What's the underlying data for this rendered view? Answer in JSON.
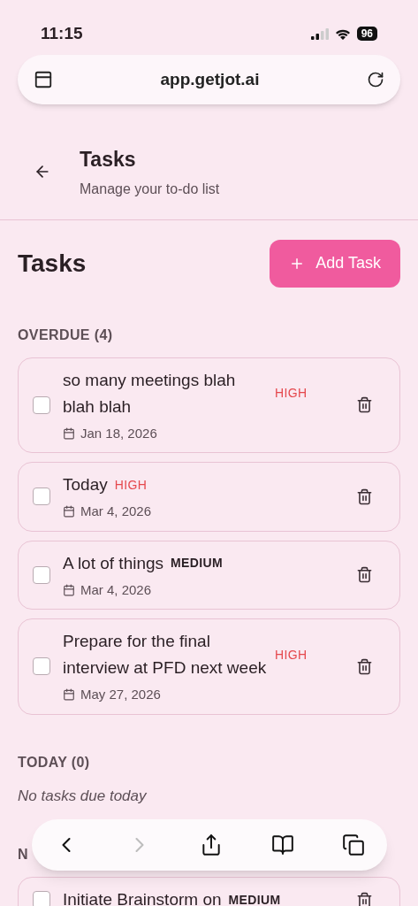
{
  "status_bar": {
    "time": "11:15",
    "battery": "96"
  },
  "address_bar": {
    "url": "app.getjot.ai"
  },
  "header": {
    "title": "Tasks",
    "subtitle": "Manage your to-do list"
  },
  "page": {
    "title": "Tasks",
    "add_button": "Add Task"
  },
  "sections": [
    {
      "heading": "OVERDUE (4)",
      "tasks": [
        {
          "title": "so many meetings blah blah blah",
          "priority": {
            "label": "HIGH",
            "kind": "high"
          },
          "date": "Jan 18, 2026",
          "checked": false
        },
        {
          "title": "Today",
          "priority": {
            "label": "HIGH",
            "kind": "high"
          },
          "date": "Mar 4, 2026",
          "checked": false
        },
        {
          "title": "A lot of things",
          "priority": {
            "label": "MEDIUM",
            "kind": "medium"
          },
          "date": "Mar 4, 2026",
          "checked": false
        },
        {
          "title": "Prepare for the final interview at PFD next week",
          "priority": {
            "label": "HIGH",
            "kind": "high"
          },
          "date": "May 27, 2026",
          "checked": false
        }
      ]
    },
    {
      "heading": "TODAY (0)",
      "empty_message": "No tasks due today"
    },
    {
      "heading": "N",
      "tasks": [
        {
          "title": "Initiate Brainstorm on",
          "priority": {
            "label": "MEDIUM",
            "kind": "medium"
          },
          "checked": false
        }
      ]
    }
  ],
  "toolbar": [
    {
      "kind": "back",
      "disabled": false
    },
    {
      "kind": "forward",
      "disabled": true
    },
    {
      "kind": "share",
      "disabled": false
    },
    {
      "kind": "bookmarks",
      "disabled": false
    },
    {
      "kind": "tabs",
      "disabled": false
    }
  ]
}
